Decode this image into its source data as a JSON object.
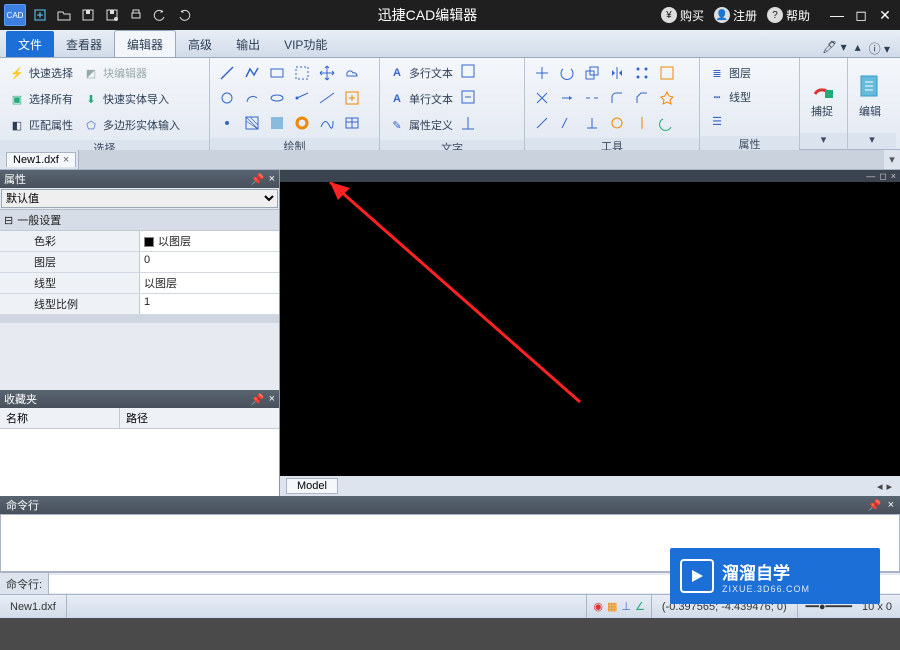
{
  "title": "迅捷CAD编辑器",
  "titlebar": {
    "buy": "购买",
    "register": "注册",
    "help": "帮助"
  },
  "tabs": {
    "file": "文件",
    "viewer": "查看器",
    "editor": "编辑器",
    "advanced": "高级",
    "output": "输出",
    "vip": "VIP功能"
  },
  "ribbon": {
    "select": {
      "label": "选择",
      "quick": "快速选择",
      "block": "块编辑器",
      "all": "选择所有",
      "import": "快速实体导入",
      "match": "匹配属性",
      "poly": "多边形实体输入"
    },
    "draw": {
      "label": "绘制"
    },
    "text": {
      "label": "文字",
      "mtext": "多行文本",
      "stext": "单行文本",
      "attr": "属性定义"
    },
    "tools": {
      "label": "工具"
    },
    "props": {
      "label": "属性",
      "layer": "图层",
      "ltype": "线型"
    },
    "snap": "捕捉",
    "edit": "编辑"
  },
  "doc": {
    "name": "New1.dxf"
  },
  "propPanel": {
    "title": "属性",
    "default": "默认值",
    "section": "一般设置",
    "rows": {
      "color": {
        "k": "色彩",
        "v": "以图层"
      },
      "layer": {
        "k": "图层",
        "v": "0"
      },
      "ltype": {
        "k": "线型",
        "v": "以图层"
      },
      "lscale": {
        "k": "线型比例",
        "v": "1"
      }
    }
  },
  "fav": {
    "title": "收藏夹",
    "col1": "名称",
    "col2": "路径"
  },
  "model": "Model",
  "cmd": {
    "title": "命令行",
    "prompt": "命令行:"
  },
  "status": {
    "file": "New1.dxf",
    "coord": "(-0.397565; -4.439476; 0)",
    "zoom": "10 x 0"
  },
  "watermark": {
    "t1": "溜溜自学",
    "t2": "ZIXUE.3D66.COM"
  }
}
